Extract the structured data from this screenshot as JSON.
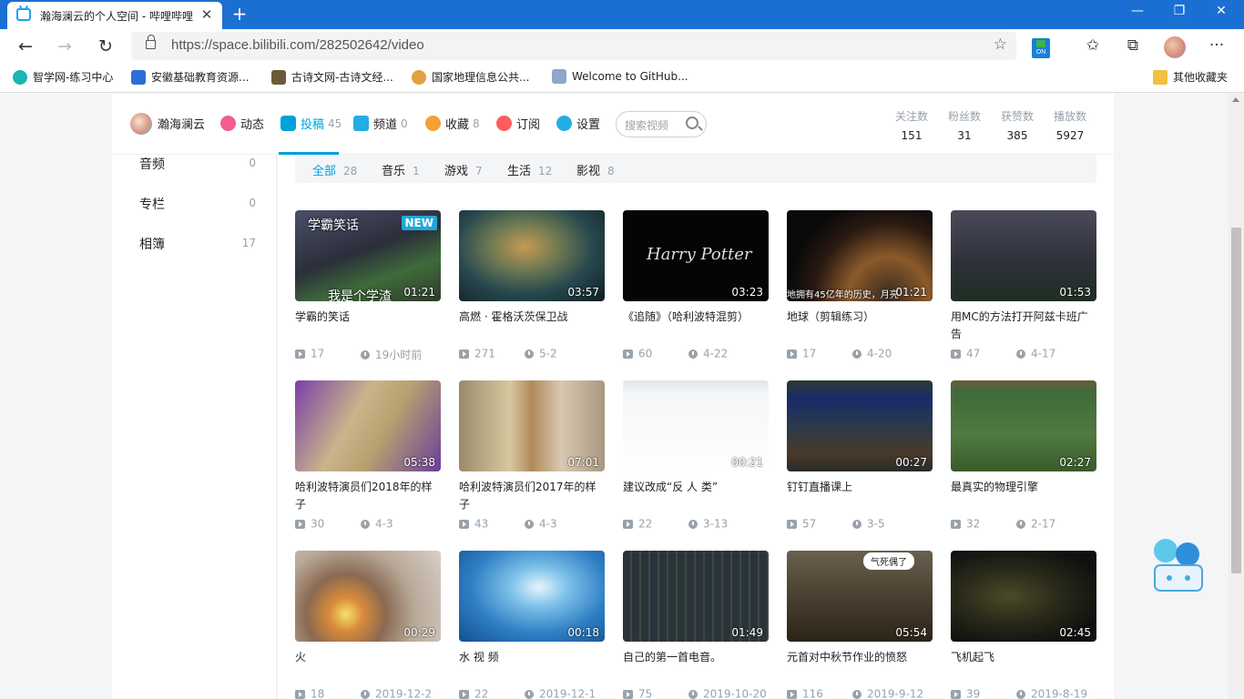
{
  "browser": {
    "tab_title": "瀚海澜云的个人空间 - 哔哩哔哩 (",
    "tab_close": "✕",
    "new_tab": "+",
    "url": "https://space.bilibili.com/282502642/video",
    "ext_label": "ON",
    "bookmarks": [
      {
        "label": "智学网-练习中心",
        "color": "#19b7b3"
      },
      {
        "label": "安徽基础教育资源...",
        "color": "#2b6fd6"
      },
      {
        "label": "古诗文网-古诗文经...",
        "color": "#6b5a3a"
      },
      {
        "label": "国家地理信息公共...",
        "color": "#e2a040"
      },
      {
        "label": "Welcome to GitHub...",
        "color": "#8fa7c8"
      }
    ],
    "other_bookmarks": "其他收藏夹"
  },
  "header": {
    "username": "瀚海澜云",
    "nav": [
      {
        "label": "动态",
        "count": "",
        "color": "#f25d8e"
      },
      {
        "label": "投稿",
        "count": "45",
        "color": "#00a1d6"
      },
      {
        "label": "频道",
        "count": "0",
        "color": "#23ade5"
      },
      {
        "label": "收藏",
        "count": "8",
        "color": "#f3a034"
      },
      {
        "label": "订阅",
        "count": "",
        "color": "#ff5c5c"
      },
      {
        "label": "设置",
        "count": "",
        "color": "#23ade5"
      }
    ],
    "search_placeholder": "搜索视频",
    "stats": [
      {
        "label": "关注数",
        "value": "151"
      },
      {
        "label": "粉丝数",
        "value": "31"
      },
      {
        "label": "获赞数",
        "value": "385"
      },
      {
        "label": "播放数",
        "value": "5927"
      }
    ]
  },
  "sidebar": {
    "items": [
      {
        "label": "音频",
        "count": "0"
      },
      {
        "label": "专栏",
        "count": "0"
      },
      {
        "label": "相簿",
        "count": "17"
      }
    ]
  },
  "filters": [
    {
      "label": "全部",
      "count": "28"
    },
    {
      "label": "音乐",
      "count": "1"
    },
    {
      "label": "游戏",
      "count": "7"
    },
    {
      "label": "生活",
      "count": "12"
    },
    {
      "label": "影视",
      "count": "8"
    }
  ],
  "videos": [
    {
      "title": "学霸的笑话",
      "duration": "01:21",
      "plays": "17",
      "date": "19小时前",
      "badge": "NEW",
      "caption_top": "学霸笑话",
      "caption_bottom": "我是个学渣"
    },
    {
      "title": "高燃 · 霍格沃茨保卫战",
      "duration": "03:57",
      "plays": "271",
      "date": "5-2"
    },
    {
      "title": "《追随》（哈利波特混剪）",
      "duration": "03:23",
      "plays": "60",
      "date": "4-22",
      "caption_center": "Harry Potter"
    },
    {
      "title": "地球（剪辑练习）",
      "duration": "01:21",
      "plays": "17",
      "date": "4-20",
      "caption_bottom": "地拥有45亿年的历史，月亮"
    },
    {
      "title": "用MC的方法打开阿兹卡班广告",
      "duration": "01:53",
      "plays": "47",
      "date": "4-17"
    },
    {
      "title": "哈利波特演员们2018年的样子",
      "duration": "05:38",
      "plays": "30",
      "date": "4-3"
    },
    {
      "title": "哈利波特演员们2017年的样子",
      "duration": "07:01",
      "plays": "43",
      "date": "4-3"
    },
    {
      "title": "建议改成“反 人 类”",
      "duration": "00:21",
      "plays": "22",
      "date": "3-13"
    },
    {
      "title": "钉钉直播课上",
      "duration": "00:27",
      "plays": "57",
      "date": "3-5"
    },
    {
      "title": "最真实的物理引擎",
      "duration": "02:27",
      "plays": "32",
      "date": "2-17"
    },
    {
      "title": "火",
      "duration": "00:29",
      "plays": "18",
      "date": "2019-12-2"
    },
    {
      "title": "水 视 频",
      "duration": "00:18",
      "plays": "22",
      "date": "2019-12-1"
    },
    {
      "title": "自己的第一首电音。",
      "duration": "01:49",
      "plays": "75",
      "date": "2019-10-20"
    },
    {
      "title": "元首对中秋节作业的愤怒",
      "duration": "05:54",
      "plays": "116",
      "date": "2019-9-12",
      "caption_top": "气死偶了"
    },
    {
      "title": "飞机起飞",
      "duration": "02:45",
      "plays": "39",
      "date": "2019-8-19"
    }
  ]
}
